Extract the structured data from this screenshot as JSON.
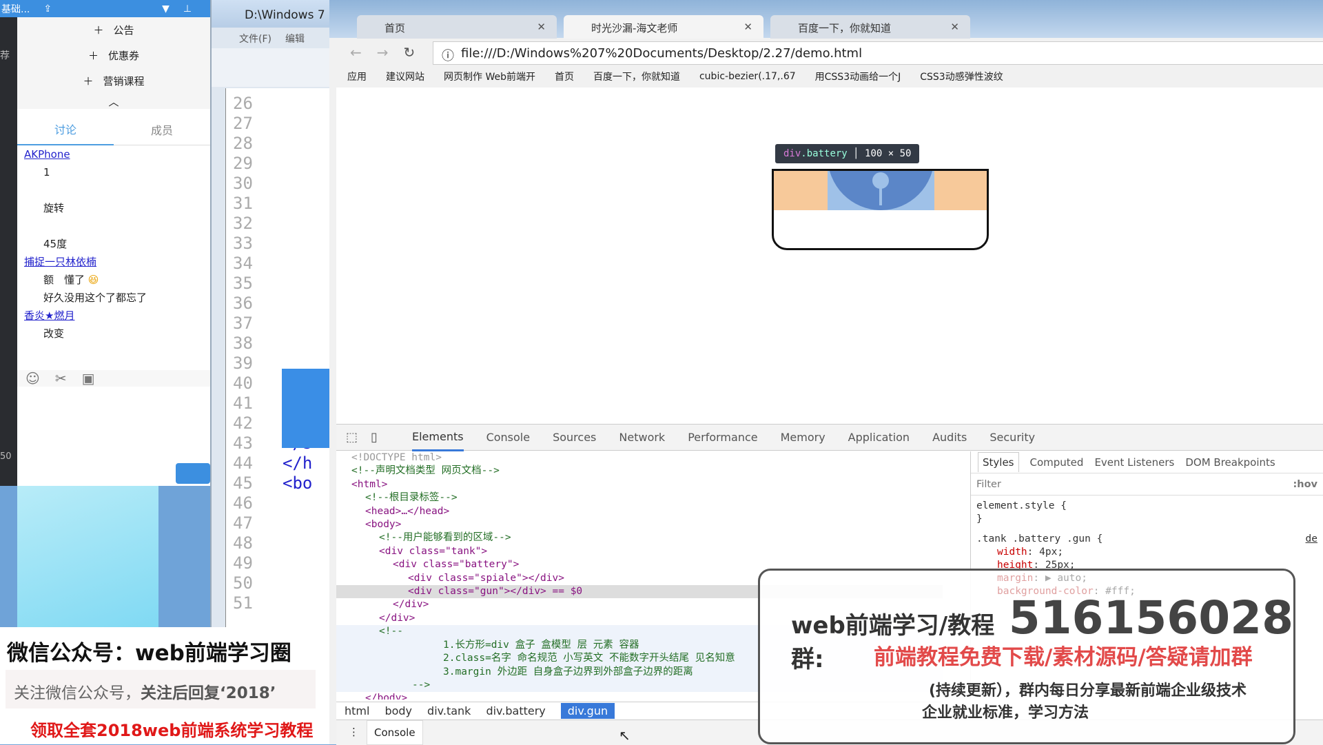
{
  "taskbar": {
    "title": "基础...",
    "share_icon": "share-icon",
    "dropdown_icon": "chevron-down-icon",
    "pin_icon": "pin-icon"
  },
  "left_strip": {
    "label1": "荐",
    "label2": "50"
  },
  "qq": {
    "menu": [
      {
        "label": "公告"
      },
      {
        "label": "优惠券"
      },
      {
        "label": "营销课程"
      }
    ],
    "tabs": [
      {
        "label": "讨论"
      },
      {
        "label": "成员"
      }
    ],
    "messages": [
      {
        "user": "AKPhone",
        "lines": [
          "1",
          "旋转",
          "45度"
        ]
      },
      {
        "user": "捕捉一只林依楠",
        "lines": [
          "额　懂了",
          "好久没用这个了都忘了"
        ]
      },
      {
        "user": "香炎★燃月",
        "lines": [
          "改变"
        ]
      }
    ]
  },
  "editor": {
    "title": "D:\\Windows 7",
    "menu": [
      "文件(F)",
      "编辑"
    ],
    "line_numbers": [
      "26",
      "27",
      "28",
      "29",
      "30",
      "31",
      "32",
      "33",
      "34",
      "35",
      "36",
      "37",
      "38",
      "39",
      "40",
      "41",
      "42",
      "43",
      "44",
      "45",
      "46",
      "47",
      "48",
      "49",
      "50",
      "51"
    ],
    "code": [
      "</s",
      "</h",
      "<bo"
    ]
  },
  "browser": {
    "tabs": [
      {
        "label": "首页"
      },
      {
        "label": "时光沙漏-海文老师"
      },
      {
        "label": "百度一下，你就知道"
      }
    ],
    "url": "file:///D:/Windows%207%20Documents/Desktop/2.27/demo.html",
    "bookmarks": [
      "应用",
      "建议网站",
      "网页制作 Web前端开",
      "首页",
      "百度一下，你就知道",
      "cubic-bezier(.17,.67",
      "用CSS3动画给一个J",
      "CSS3动感弹性波纹"
    ]
  },
  "page": {
    "tooltip_tag": "div",
    "tooltip_class": ".battery",
    "tooltip_size": "100 × 50",
    "colors": {
      "margin": "#f7c99a",
      "content": "#9fc1e8",
      "battery": "#5b86c8"
    }
  },
  "devtools": {
    "tabs": [
      "Elements",
      "Console",
      "Sources",
      "Network",
      "Performance",
      "Memory",
      "Application",
      "Audits",
      "Security"
    ],
    "dom": [
      "<!DOCTYPE html>",
      "<!--声明文档类型 网页文档-->",
      "<html>",
      "<!--根目录标签-->",
      "<head>…</head>",
      "<body>",
      "<!--用户能够看到的区域-->",
      "<div class=\"tank\">",
      "<div class=\"battery\">",
      "<div class=\"spiale\"></div>",
      "<div class=\"gun\"></div> == $0",
      "</div>",
      "</div>",
      "<!--",
      "1.长方形=div 盒子 盒模型 层 元素 容器",
      "2.class=名字 命名规范 小写英文 不能数字开头结尾 见名知意",
      "3.margin 外边距 自身盒子边界到外部盒子边界的距离",
      "-->",
      "</body>"
    ],
    "breadcrumbs": [
      "html",
      "body",
      "div.tank",
      "div.battery",
      "div.gun"
    ],
    "drawer_tab": "Console",
    "styles_tabs": [
      "Styles",
      "Computed",
      "Event Listeners",
      "DOM Breakpoints"
    ],
    "filter_placeholder": "Filter",
    "hov": ":hov",
    "element_style": "element.style {",
    "close_brace": "}",
    "rule_selector": ".tank .battery .gun {",
    "rule_source": "de",
    "props": [
      {
        "name": "width",
        "value": "4px;"
      },
      {
        "name": "height",
        "value": "25px;"
      },
      {
        "name": "margin",
        "value": "▶ auto;"
      },
      {
        "name": "background-color",
        "value": "#fff;"
      }
    ]
  },
  "ad": {
    "group_label": "web前端学习/教程群:",
    "group_number": "516156028",
    "red_line": "前端教程免费下载/素材源码/答疑请加群",
    "line3": "(持续更新），群内每日分享最新前端企业级技术",
    "line4": "企业就业标准，学习方法"
  },
  "promo": {
    "title": "微信公众号：web前端学习圈",
    "subtitle_a": "关注微信公众号，",
    "subtitle_b": "关注后回复‘2018’",
    "red": "领取全套2018web前端系统学习教程"
  }
}
